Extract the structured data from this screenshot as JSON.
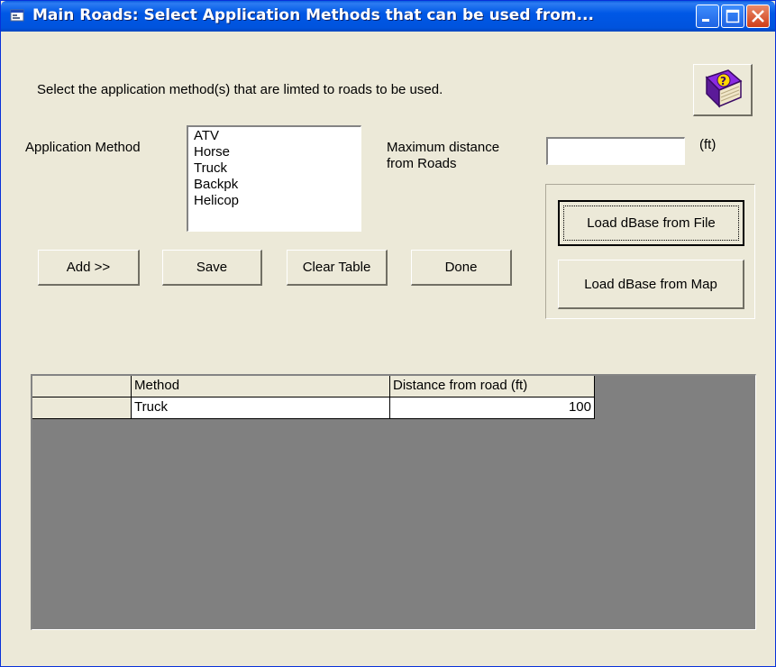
{
  "window": {
    "title": "Main Roads: Select Application Methods that can be used from...",
    "accent_color": "#0054e3",
    "title_icon": "form-icon"
  },
  "title_buttons": {
    "minimize_icon": "minimize-icon",
    "maximize_icon": "maximize-icon",
    "close_icon": "close-icon"
  },
  "instructions": "Select the application method(s) that are limted to roads to be used.",
  "help_button": {
    "icon": "help-book-icon"
  },
  "method": {
    "label": "Application Method",
    "items": [
      "ATV",
      "Horse",
      "Truck",
      "Backpk",
      "Helicop"
    ]
  },
  "distance": {
    "label_line1": "Maximum distance",
    "label_line2": "from Roads",
    "value": "",
    "unit": "(ft)"
  },
  "buttons": {
    "add": "Add >>",
    "save": "Save",
    "clear": "Clear Table",
    "done": "Done",
    "load_file": "Load dBase from File",
    "load_map": "Load dBase from Map"
  },
  "table": {
    "columns": [
      "Method",
      "Distance from road (ft)"
    ],
    "rows": [
      {
        "method": "Truck",
        "distance": "100"
      }
    ]
  }
}
